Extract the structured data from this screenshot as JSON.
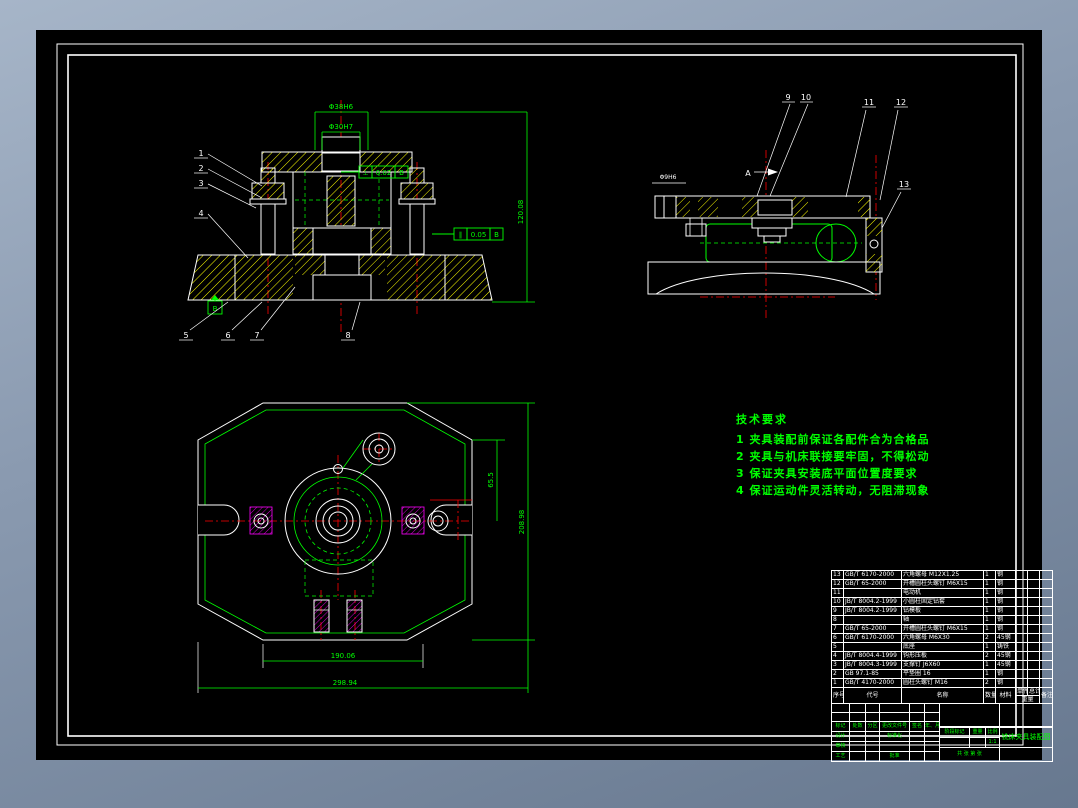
{
  "colors": {
    "green": "#00ff00",
    "red": "#ff0000",
    "yellow": "#ffff00",
    "magenta": "#ff00ff",
    "white": "#ffffff",
    "canvas": "#000000"
  },
  "tech_requirements": {
    "title": "技术要求",
    "items": [
      "1 夹具装配前保证各配件合为合格品",
      "2 夹具与机床联接要牢固，不得松动",
      "3 保证夹具安装底平面位置度要求",
      "4 保证运动件灵活转动，无阻滞现象"
    ]
  },
  "dims": {
    "front_outer": "Φ38H6",
    "front_inner": "Φ30H7",
    "front_height": "120.08",
    "side_left": "Φ9H6",
    "section": "A",
    "plan_side": "65.5",
    "plan_height": "208.98",
    "plan_inner": "190.06",
    "plan_outer": "298.94"
  },
  "fcf1": {
    "sym": "⊥",
    "val": "0.02",
    "ref": "B"
  },
  "fcf2": {
    "sym": "∥",
    "val": "0.05",
    "ref": "B"
  },
  "datum": {
    "label": "B"
  },
  "callouts": {
    "front": [
      "1",
      "2",
      "3",
      "4",
      "5",
      "6",
      "7",
      "8"
    ],
    "side": [
      "9",
      "10",
      "11",
      "12",
      "13"
    ]
  },
  "parts_list": {
    "headers": {
      "no": "序号",
      "code": "代号",
      "name": "名称",
      "qty": "数量",
      "mat": "材料",
      "unit": "单件",
      "total": "总计",
      "weight": "重量",
      "remark": "备注"
    },
    "rows": [
      {
        "no": "13",
        "code": "GB/T 6170-2000",
        "name": "六角螺母 M12X1.25",
        "qty": "1",
        "mat": "钢"
      },
      {
        "no": "12",
        "code": "GB/T 65-2000",
        "name": "开槽圆柱头螺钉 M6X15",
        "qty": "1",
        "mat": "钢"
      },
      {
        "no": "11",
        "code": "",
        "name": "电动机",
        "qty": "1",
        "mat": "钢"
      },
      {
        "no": "10",
        "code": "JB/T 8004.2-1999",
        "name": "小圆柱固定钻套",
        "qty": "1",
        "mat": "钢"
      },
      {
        "no": "9",
        "code": "JB/T 8004.2-1999",
        "name": "钻模板",
        "qty": "1",
        "mat": "钢"
      },
      {
        "no": "8",
        "code": "",
        "name": "轴",
        "qty": "1",
        "mat": "钢"
      },
      {
        "no": "7",
        "code": "GB/T 65-2000",
        "name": "开槽圆柱头螺钉 M6X15",
        "qty": "1",
        "mat": "钢"
      },
      {
        "no": "6",
        "code": "GB/T 6170-2000",
        "name": "六角螺母 M6X30",
        "qty": "2",
        "mat": "45钢"
      },
      {
        "no": "5",
        "code": "",
        "name": "底座",
        "qty": "1",
        "mat": "铸铁"
      },
      {
        "no": "4",
        "code": "JB/T 8004.4-1999",
        "name": "钩形压板",
        "qty": "2",
        "mat": "45钢"
      },
      {
        "no": "3",
        "code": "JB/T 8004.3-1999",
        "name": "支撑钉 J6X60",
        "qty": "1",
        "mat": "45钢"
      },
      {
        "no": "2",
        "code": "GB 97.1-85",
        "name": "平垫圈 16",
        "qty": "1",
        "mat": "钢"
      },
      {
        "no": "1",
        "code": "GB/T 4170-2000",
        "name": "圆柱头螺钉 M16",
        "qty": "2",
        "mat": "钢"
      }
    ]
  },
  "title_block": {
    "row1": [
      "标记",
      "处数",
      "分区",
      "更改文件号",
      "签名",
      "年、月、日"
    ],
    "design": "设计",
    "standardize": "标准化",
    "audit": "审核",
    "craft": "工艺",
    "approve": "批准",
    "stage": "阶段标记",
    "weight": "重量",
    "scale_label": "比例",
    "scale": "1:1",
    "sheet_note": "共 张 第 张",
    "title": "铣床夹具装配图"
  }
}
